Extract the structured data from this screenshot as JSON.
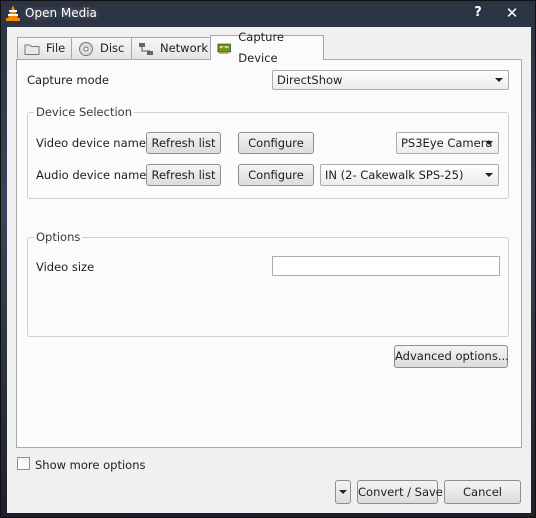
{
  "window": {
    "title": "Open Media",
    "help_glyph": "?",
    "close_glyph": "✕"
  },
  "tabs": [
    {
      "label": "File",
      "icon": "folder-icon"
    },
    {
      "label": "Disc",
      "icon": "disc-icon"
    },
    {
      "label": "Network",
      "icon": "network-icon"
    },
    {
      "label": "Capture Device",
      "icon": "capture-card-icon",
      "active": true
    }
  ],
  "capture": {
    "mode_label": "Capture mode",
    "mode_value": "DirectShow"
  },
  "device_selection": {
    "title": "Device Selection",
    "video_label": "Video device name",
    "audio_label": "Audio device name",
    "refresh_label": "Refresh list",
    "configure_label": "Configure",
    "video_device": "PS3Eye Camera",
    "audio_device": "IN (2- Cakewalk SPS-25)"
  },
  "options": {
    "title": "Options",
    "video_size_label": "Video size",
    "video_size_value": ""
  },
  "advanced_label": "Advanced options...",
  "show_more_label": "Show more options",
  "show_more_checked": false,
  "footer": {
    "convert_label": "Convert / Save",
    "cancel_label": "Cancel"
  }
}
